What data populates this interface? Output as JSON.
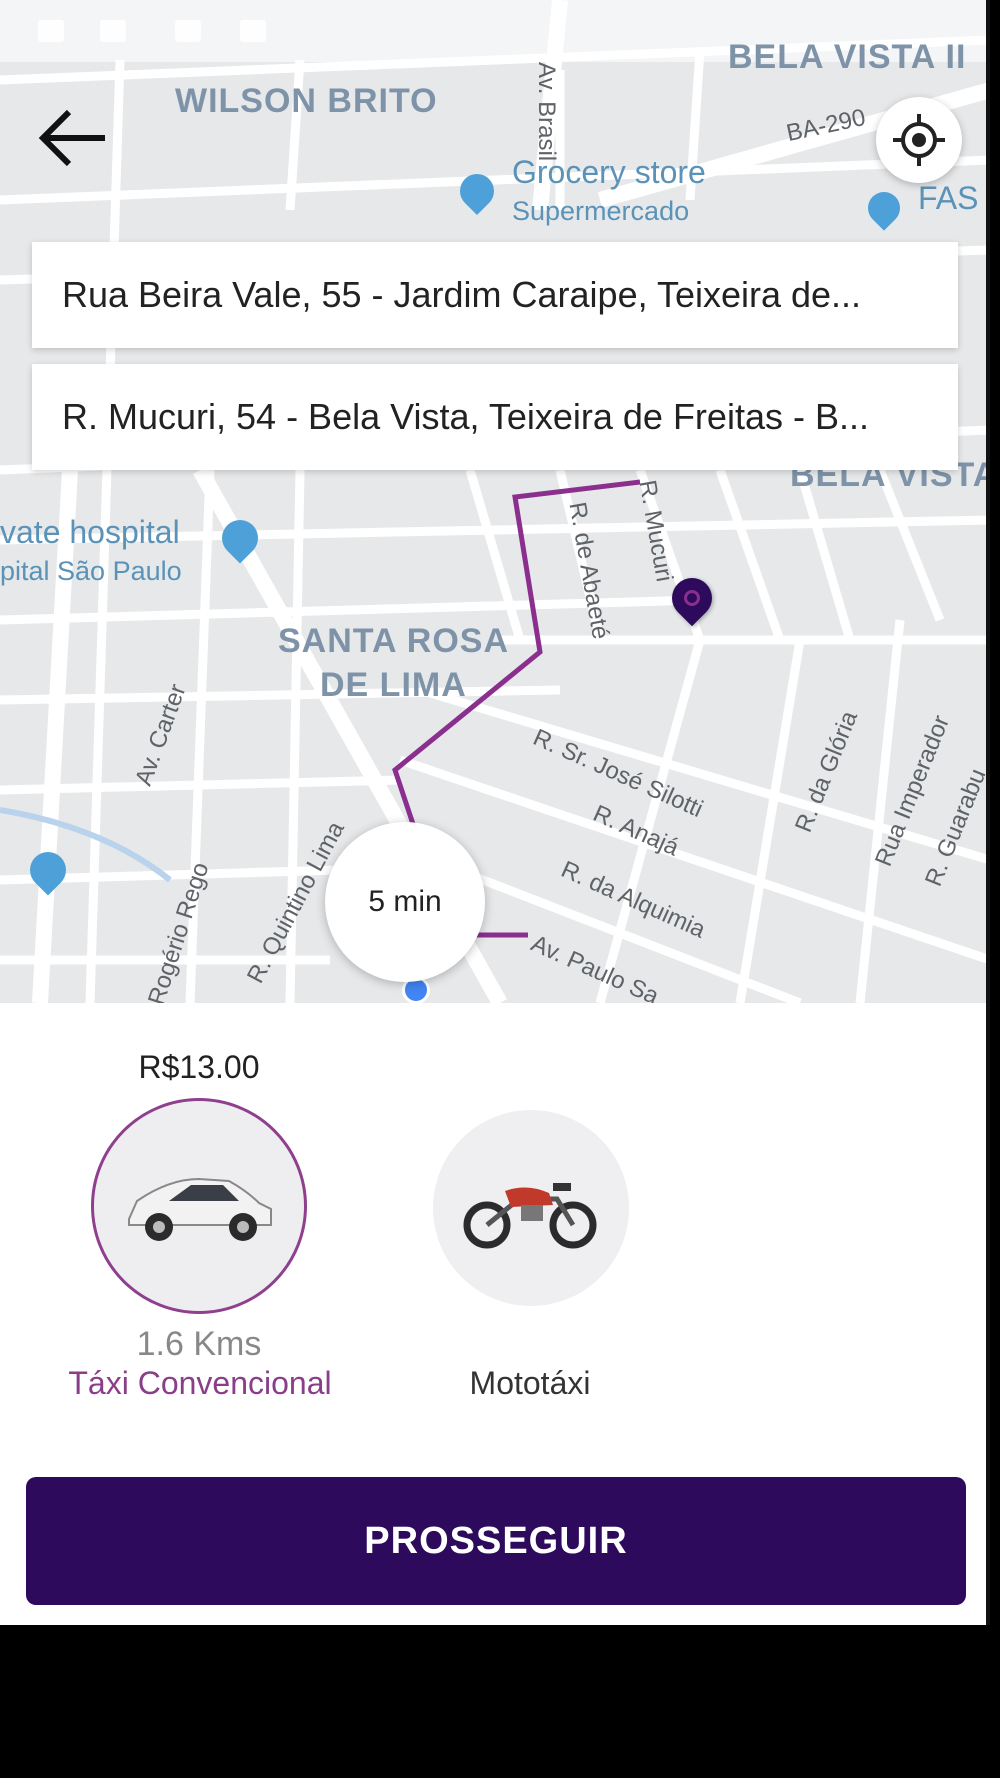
{
  "map": {
    "neighborhoods": [
      "WILSON BRITO",
      "BELA VISTA II",
      "BELA VISTA",
      "SANTA ROSA",
      "DE LIMA"
    ],
    "pois": {
      "grocery_name": "Grocery store",
      "grocery_sub": "Supermercado",
      "hospital_name": "vate hospital",
      "hospital_sub": "pital São Paulo",
      "fas": "FAS"
    },
    "streets": [
      "Av. Brasil",
      "BA-290",
      "Av. Carter",
      "R. Quintino Lima",
      "Rogério Rego",
      "R. Sr. José Silotti",
      "R. Anajá",
      "R. da Alquimia",
      "R. da Glória",
      "Rua Imperador",
      "R. Guarabu",
      "R. Mucuri",
      "R. de Abaeté",
      "Av. Paulo Sa"
    ],
    "route_color": "#8b2f8f",
    "pin_color": "#2d0a5c",
    "user_dot_color": "#4285f4"
  },
  "addresses": {
    "origin": "Rua Beira Vale, 55 - Jardim Caraipe, Teixeira de...",
    "destination": "R. Mucuri, 54 - Bela Vista, Teixeira de Freitas - B..."
  },
  "eta": "5 min",
  "vehicles": {
    "car": {
      "price": "R$13.00",
      "distance": "1.6 Kms",
      "label": "Táxi Convencional",
      "icon": "car-icon"
    },
    "moto": {
      "label": "Mototáxi",
      "icon": "motorcycle-icon"
    }
  },
  "actions": {
    "proceed": "PROSSEGUIR"
  },
  "colors": {
    "accent": "#2d0a5c",
    "selected": "#8a3e8a"
  }
}
